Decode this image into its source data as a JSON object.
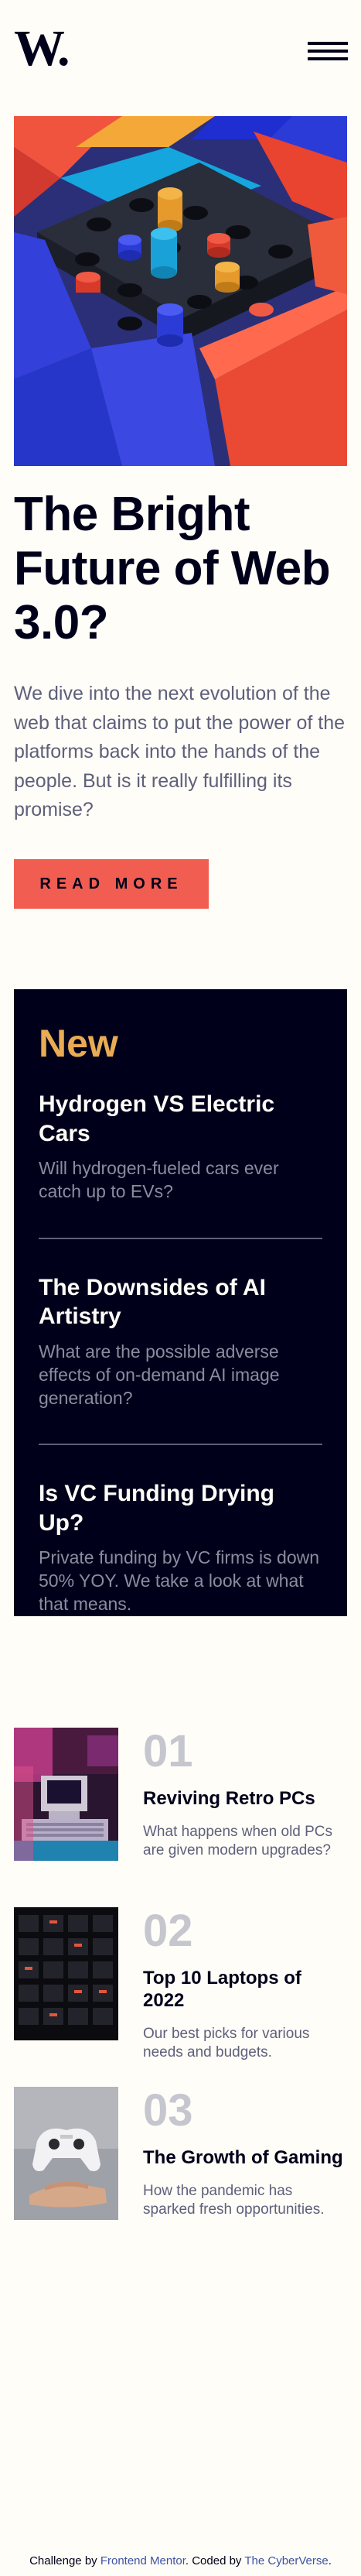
{
  "header": {
    "logo": "W.",
    "menu_icon": "hamburger-menu-icon"
  },
  "hero": {
    "image_alt": "abstract colorful 3D blocks",
    "title": "The Bright Future of Web 3.0?",
    "description": "We dive into the next evolution of the web that claims to put the power of the platforms back into the hands of the people. But is it really fulfilling its promise?",
    "button_label": "Read more"
  },
  "new_section": {
    "heading": "New",
    "items": [
      {
        "title": "Hydrogen VS Electric Cars",
        "description": "Will hydrogen-fueled cars ever catch up to EVs?"
      },
      {
        "title": "The Downsides of AI Artistry",
        "description": "What are the possible adverse effects of on-demand AI image generation?"
      },
      {
        "title": "Is VC Funding Drying Up?",
        "description": "Private funding by VC firms is down 50% YOY. We take a look at what that means."
      }
    ]
  },
  "articles": [
    {
      "number": "01",
      "title": "Reviving Retro PCs",
      "description": "What happens when old PCs are given modern upgrades?",
      "image": "retro-pc"
    },
    {
      "number": "02",
      "title": "Top 10 Laptops of 2022",
      "description": "Our best picks for various needs and budgets.",
      "image": "keyboard"
    },
    {
      "number": "03",
      "title": "The Growth of Gaming",
      "description": "How the pandemic has sparked fresh opportunities.",
      "image": "gamepad"
    }
  ],
  "footer": {
    "prefix": "Challenge by ",
    "challenge_link": "Frontend Mentor",
    "middle": ". Coded by ",
    "author_link": "The CyberVerse",
    "suffix": "."
  },
  "colors": {
    "accent_red": "#f15d51",
    "accent_orange": "#e9ab53",
    "dark_navy": "#00001a",
    "background": "#fffdf8",
    "muted_text": "#5e607a",
    "link_blue": "#3e52a3"
  }
}
